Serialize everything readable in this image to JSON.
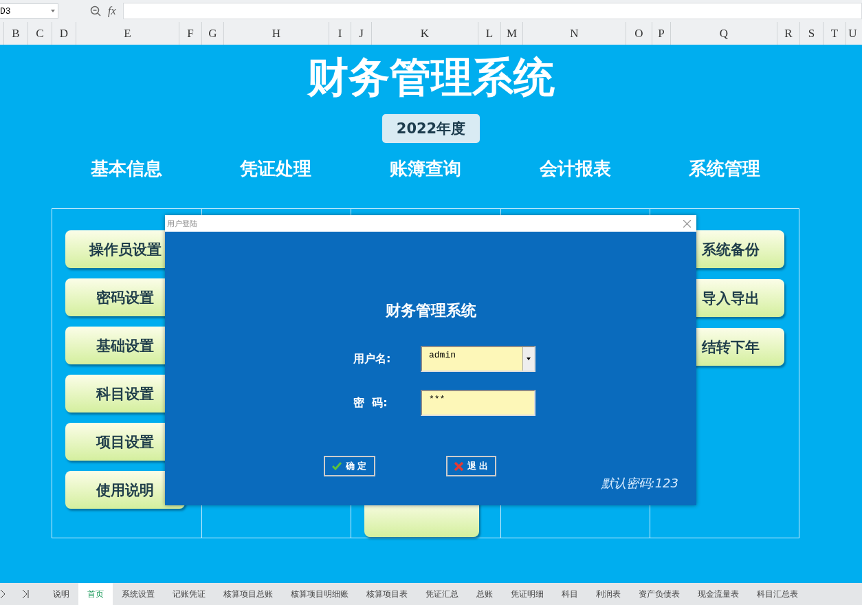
{
  "formula_bar": {
    "name_box": "D3",
    "fx": "fx"
  },
  "columns": [
    "B",
    "C",
    "D",
    "E",
    "F",
    "G",
    "H",
    "I",
    "J",
    "K",
    "L",
    "M",
    "N",
    "O",
    "P",
    "Q",
    "R",
    "S",
    "T",
    "U"
  ],
  "title": "财务管理系统",
  "year": "2022年度",
  "sections": [
    {
      "heading": "基本信息",
      "buttons": [
        "操作员设置",
        "密码设置",
        "基础设置",
        "科目设置",
        "项目设置",
        "使用说明"
      ]
    },
    {
      "heading": "凭证处理"
    },
    {
      "heading": "账簿查询"
    },
    {
      "heading": "会计报表"
    },
    {
      "heading": "系统管理",
      "buttons": [
        "系统备份",
        "导入导出",
        "结转下年"
      ]
    }
  ],
  "dialog": {
    "title": "用户登陆",
    "heading": "财务管理系统",
    "fields": [
      {
        "kind": "combo",
        "label": "用户名:",
        "value": "admin"
      },
      {
        "kind": "password",
        "label": "密  码:",
        "value": "***"
      }
    ],
    "buttons": [
      {
        "kind": "ok",
        "label": "确 定"
      },
      {
        "kind": "cancel",
        "label": "退 出"
      }
    ],
    "hint": "默认密码:123"
  },
  "sheet_tabs": [
    {
      "label": "说明",
      "selected": false
    },
    {
      "label": "首页",
      "selected": true
    },
    {
      "label": "系统设置",
      "selected": false
    },
    {
      "label": "记账凭证",
      "selected": false
    },
    {
      "label": "核算项目总账",
      "selected": false
    },
    {
      "label": "核算项目明细账",
      "selected": false
    },
    {
      "label": "核算项目表",
      "selected": false
    },
    {
      "label": "凭证汇总",
      "selected": false
    },
    {
      "label": "总账",
      "selected": false
    },
    {
      "label": "凭证明细",
      "selected": false
    },
    {
      "label": "科目",
      "selected": false
    },
    {
      "label": "利润表",
      "selected": false
    },
    {
      "label": "资产负债表",
      "selected": false
    },
    {
      "label": "现金流量表",
      "selected": false
    },
    {
      "label": "科目汇总表",
      "selected": false
    }
  ]
}
